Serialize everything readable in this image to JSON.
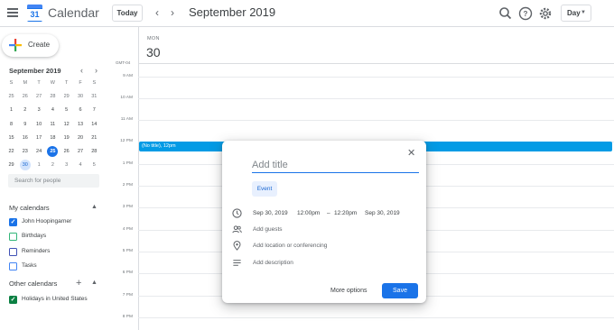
{
  "header": {
    "logo_day": "31",
    "app_title": "Calendar",
    "today_label": "Today",
    "prev_icon": "chevron-left-icon",
    "next_icon": "chevron-right-icon",
    "month_title": "September 2019",
    "icons": [
      "search-icon",
      "help-icon",
      "settings-icon"
    ],
    "view_label": "Day"
  },
  "sidebar": {
    "create_label": "Create",
    "mini_cal": {
      "title": "September 2019",
      "weekdays": [
        "S",
        "M",
        "T",
        "W",
        "T",
        "F",
        "S"
      ],
      "weeks": [
        [
          {
            "d": "25",
            "t": "dim"
          },
          {
            "d": "26",
            "t": "dim"
          },
          {
            "d": "27",
            "t": "dim"
          },
          {
            "d": "28",
            "t": "dim"
          },
          {
            "d": "29",
            "t": "dim"
          },
          {
            "d": "30",
            "t": "dim"
          },
          {
            "d": "31",
            "t": "dim"
          }
        ],
        [
          {
            "d": "1",
            "t": ""
          },
          {
            "d": "2",
            "t": ""
          },
          {
            "d": "3",
            "t": ""
          },
          {
            "d": "4",
            "t": ""
          },
          {
            "d": "5",
            "t": ""
          },
          {
            "d": "6",
            "t": ""
          },
          {
            "d": "7",
            "t": ""
          }
        ],
        [
          {
            "d": "8",
            "t": ""
          },
          {
            "d": "9",
            "t": ""
          },
          {
            "d": "10",
            "t": ""
          },
          {
            "d": "11",
            "t": ""
          },
          {
            "d": "12",
            "t": ""
          },
          {
            "d": "13",
            "t": ""
          },
          {
            "d": "14",
            "t": ""
          }
        ],
        [
          {
            "d": "15",
            "t": ""
          },
          {
            "d": "16",
            "t": ""
          },
          {
            "d": "17",
            "t": ""
          },
          {
            "d": "18",
            "t": ""
          },
          {
            "d": "19",
            "t": ""
          },
          {
            "d": "20",
            "t": ""
          },
          {
            "d": "21",
            "t": ""
          }
        ],
        [
          {
            "d": "22",
            "t": ""
          },
          {
            "d": "23",
            "t": ""
          },
          {
            "d": "24",
            "t": ""
          },
          {
            "d": "25",
            "t": "today"
          },
          {
            "d": "26",
            "t": ""
          },
          {
            "d": "27",
            "t": ""
          },
          {
            "d": "28",
            "t": ""
          }
        ],
        [
          {
            "d": "29",
            "t": ""
          },
          {
            "d": "30",
            "t": "sel"
          },
          {
            "d": "1",
            "t": "dim"
          },
          {
            "d": "2",
            "t": "dim"
          },
          {
            "d": "3",
            "t": "dim"
          },
          {
            "d": "4",
            "t": "dim"
          },
          {
            "d": "5",
            "t": "dim"
          }
        ]
      ]
    },
    "search_placeholder": "Search for people",
    "my_calendars_title": "My calendars",
    "my_calendars": [
      {
        "name": "John Hoopingarner",
        "checked": true,
        "color": "#1a73e8"
      },
      {
        "name": "Birthdays",
        "checked": false,
        "color": "#33b679"
      },
      {
        "name": "Reminders",
        "checked": false,
        "color": "#3f51b5"
      },
      {
        "name": "Tasks",
        "checked": false,
        "color": "#4285f4"
      }
    ],
    "other_calendars_title": "Other calendars",
    "other_calendars": [
      {
        "name": "Holidays in United States",
        "checked": true,
        "color": "#0b8043"
      }
    ]
  },
  "main": {
    "day_name": "MON",
    "day_number": "30",
    "timezone": "GMT-04",
    "hours": [
      "9 AM",
      "10 AM",
      "11 AM",
      "12 PM",
      "1 PM",
      "2 PM",
      "3 PM",
      "4 PM",
      "5 PM",
      "6 PM",
      "7 PM",
      "8 PM"
    ],
    "event_label": "(No title), 12pm"
  },
  "dialog": {
    "title_placeholder": "Add title",
    "event_tab": "Event",
    "start_date": "Sep 30, 2019",
    "start_time": "12:00pm",
    "dash": "–",
    "end_time": "12:20pm",
    "end_date": "Sep 30, 2019",
    "add_guests": "Add guests",
    "add_location": "Add location or conferencing",
    "add_description": "Add description",
    "more_options": "More options",
    "save": "Save"
  },
  "colors": {
    "accent": "#1a73e8",
    "event": "#039be5"
  }
}
